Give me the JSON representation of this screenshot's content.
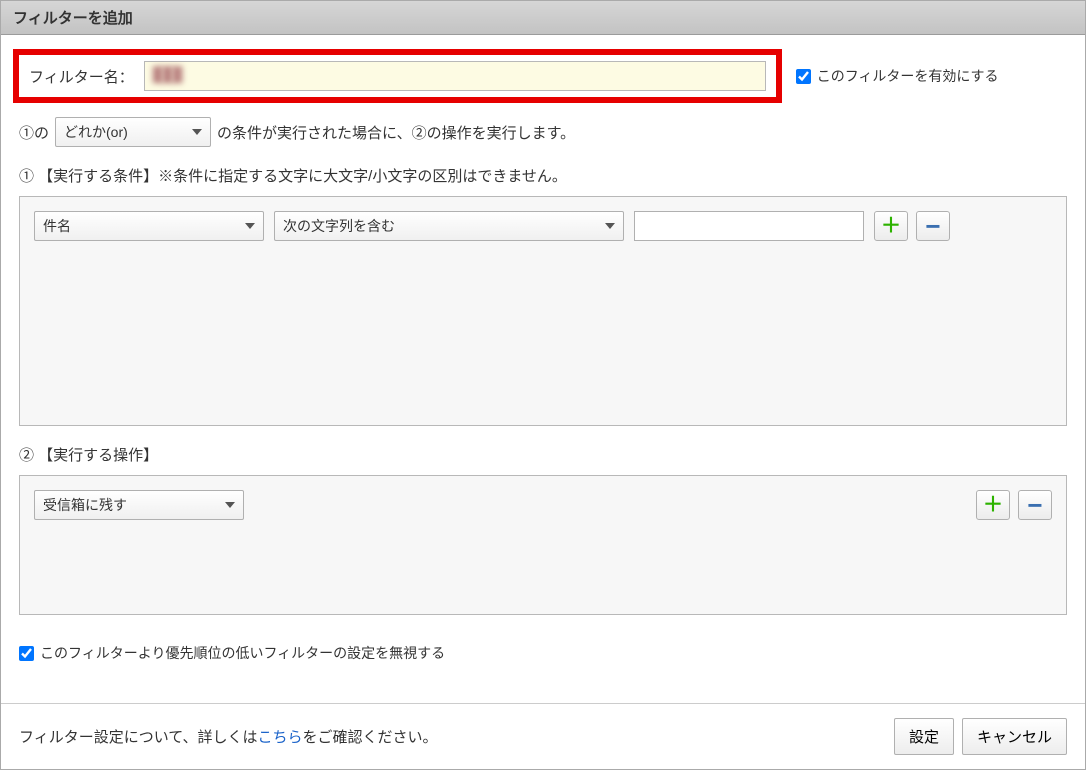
{
  "header": {
    "title": "フィルターを追加"
  },
  "name_row": {
    "label": "フィルター名：",
    "value": "███",
    "enable_label": "このフィルターを有効にする",
    "enable_checked": true
  },
  "rule_row": {
    "prefix": "①の",
    "match_select": "どれか(or)",
    "suffix": "の条件が実行された場合に、②の操作を実行します。"
  },
  "conditions": {
    "label": "① 【実行する条件】※条件に指定する文字に大文字/小文字の区別はできません。",
    "row": {
      "field": "件名",
      "operator": "次の文字列を含む",
      "value": ""
    }
  },
  "actions": {
    "label": "② 【実行する操作】",
    "row": {
      "action": "受信箱に残す"
    }
  },
  "priority_checkbox": {
    "label": "このフィルターより優先順位の低いフィルターの設定を無視する",
    "checked": true
  },
  "footer": {
    "help_prefix": "フィルター設定について、詳しくは",
    "help_link": "こちら",
    "help_suffix": "をご確認ください。",
    "submit": "設定",
    "cancel": "キャンセル"
  }
}
